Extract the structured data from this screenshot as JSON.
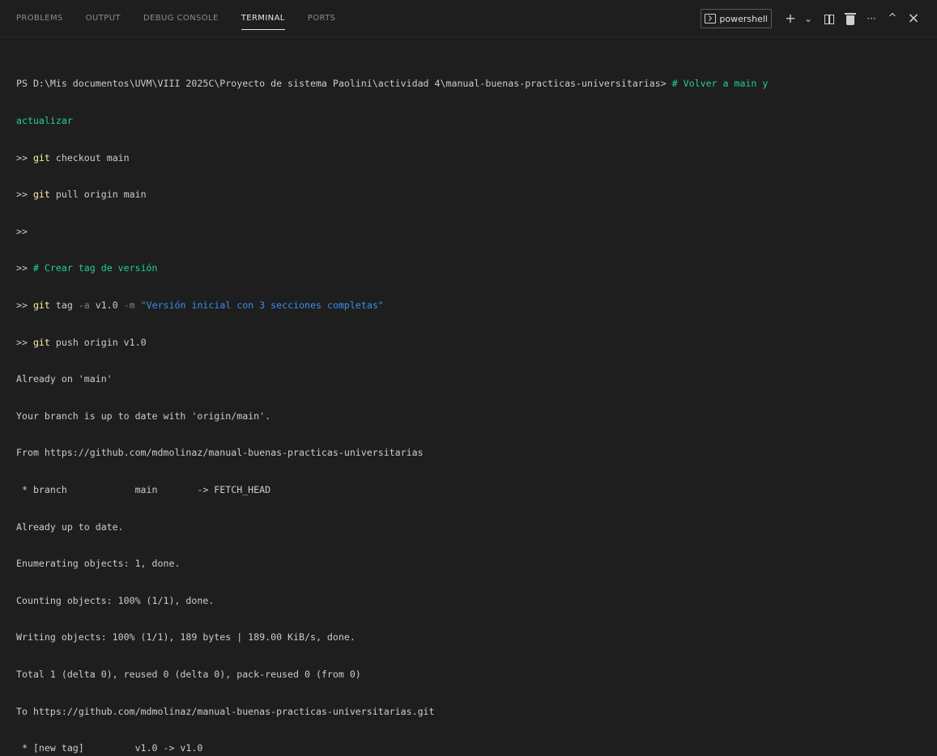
{
  "tabs": [
    "PROBLEMS",
    "OUTPUT",
    "DEBUG CONSOLE",
    "TERMINAL",
    "PORTS"
  ],
  "active_tab": "TERMINAL",
  "shell_label": "powershell",
  "actions": {
    "add": "+",
    "dropdown": "⌄",
    "more": "···",
    "maximize": "^",
    "close": "×"
  },
  "terminal": {
    "prompt_path": "PS D:\\Mis documentos\\UVM\\VIII 2025C\\Proyecto de sistema Paolini\\actividad 4\\manual-buenas-practicas-universitarias>",
    "comment1_a": "# Volver a main y",
    "comment1_b": "actualizar",
    "cont": ">>",
    "git": "git",
    "cmd1": "checkout main",
    "cmd2": "pull origin main",
    "comment2": "# Crear tag de versión",
    "cmd3_a": "tag",
    "cmd3_flag_a": "-a",
    "cmd3_b": "v1.0",
    "cmd3_flag_m": "-m",
    "cmd3_msg": "\"Versión inicial con 3 secciones completas\"",
    "cmd4": "push origin v1.0",
    "output": [
      "Already on 'main'",
      "Your branch is up to date with 'origin/main'.",
      "From https://github.com/mdmolinaz/manual-buenas-practicas-universitarias",
      " * branch            main       -> FETCH_HEAD",
      "Already up to date.",
      "Enumerating objects: 1, done.",
      "Counting objects: 100% (1/1), done.",
      "Writing objects: 100% (1/1), 189 bytes | 189.00 KiB/s, done.",
      "Total 1 (delta 0), reused 0 (delta 0), pack-reused 0 (from 0)",
      "To https://github.com/mdmolinaz/manual-buenas-practicas-universitarias.git",
      " * [new tag]         v1.0 -> v1.0"
    ]
  }
}
